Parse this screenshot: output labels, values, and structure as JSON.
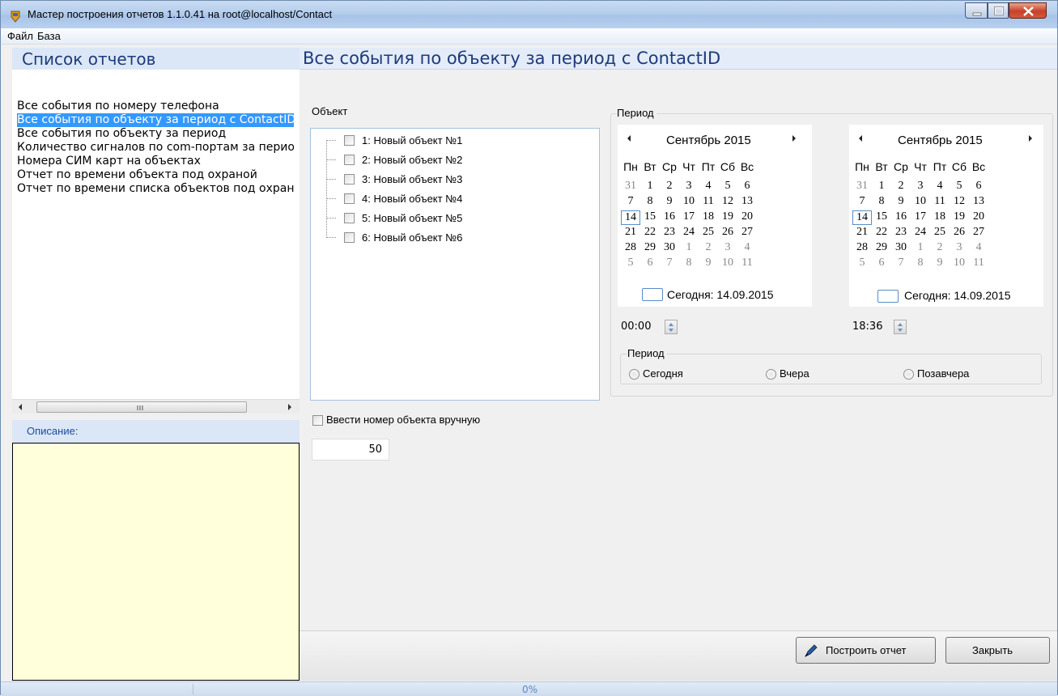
{
  "window": {
    "title": "Мастер построения отчетов 1.1.0.41 на root@localhost/Contact"
  },
  "menu": {
    "file": "Файл",
    "base": "База"
  },
  "left": {
    "header": "Список отчетов",
    "reports": [
      "Все события по номеру телефона",
      "Все события по объекту за период с ContactID",
      "Все события по объекту за период",
      "Количество сигналов по com-портам за период",
      "Номера СИМ карт на объектах",
      "Отчет по времени объекта под охраной",
      "Отчет по времени списка объектов под охраной"
    ],
    "selected_index": 1,
    "description_label": "Описание:"
  },
  "main": {
    "title": "Все события по объекту за период с ContactID",
    "object_group_label": "Объект",
    "objects": [
      "1: Новый объект №1",
      "2: Новый объект №2",
      "3: Новый объект №3",
      "4: Новый объект №4",
      "5: Новый объект №5",
      "6: Новый объект №6"
    ],
    "manual_checkbox_label": "Ввести номер объекта вручную",
    "manual_value": "50",
    "period_group_label": "Период",
    "calendar_from": {
      "month": "Сентябрь 2015",
      "today_label": "Сегодня: 14.09.2015",
      "time": "00:00"
    },
    "calendar_to": {
      "month": "Сентябрь 2015",
      "today_label": "Сегодня: 14.09.2015",
      "time": "18:36"
    },
    "weekdays": [
      "Пн",
      "Вт",
      "Ср",
      "Чт",
      "Пт",
      "Сб",
      "Вс"
    ],
    "weeks": [
      [
        "31",
        "1",
        "2",
        "3",
        "4",
        "5",
        "6"
      ],
      [
        "7",
        "8",
        "9",
        "10",
        "11",
        "12",
        "13"
      ],
      [
        "14",
        "15",
        "16",
        "17",
        "18",
        "19",
        "20"
      ],
      [
        "21",
        "22",
        "23",
        "24",
        "25",
        "26",
        "27"
      ],
      [
        "28",
        "29",
        "30",
        "1",
        "2",
        "3",
        "4"
      ],
      [
        "5",
        "6",
        "7",
        "8",
        "9",
        "10",
        "11"
      ]
    ],
    "range_group_label": "Период",
    "range_options": [
      "Сегодня",
      "Вчера",
      "Позавчера"
    ],
    "build_button": "Построить отчет",
    "close_button": "Закрыть"
  },
  "status": {
    "progress_text": "0%",
    "progress": 0
  },
  "colors": {
    "selection": "#3399ff",
    "header_text": "#1d3a7a",
    "description_bg": "#ffffdc"
  }
}
